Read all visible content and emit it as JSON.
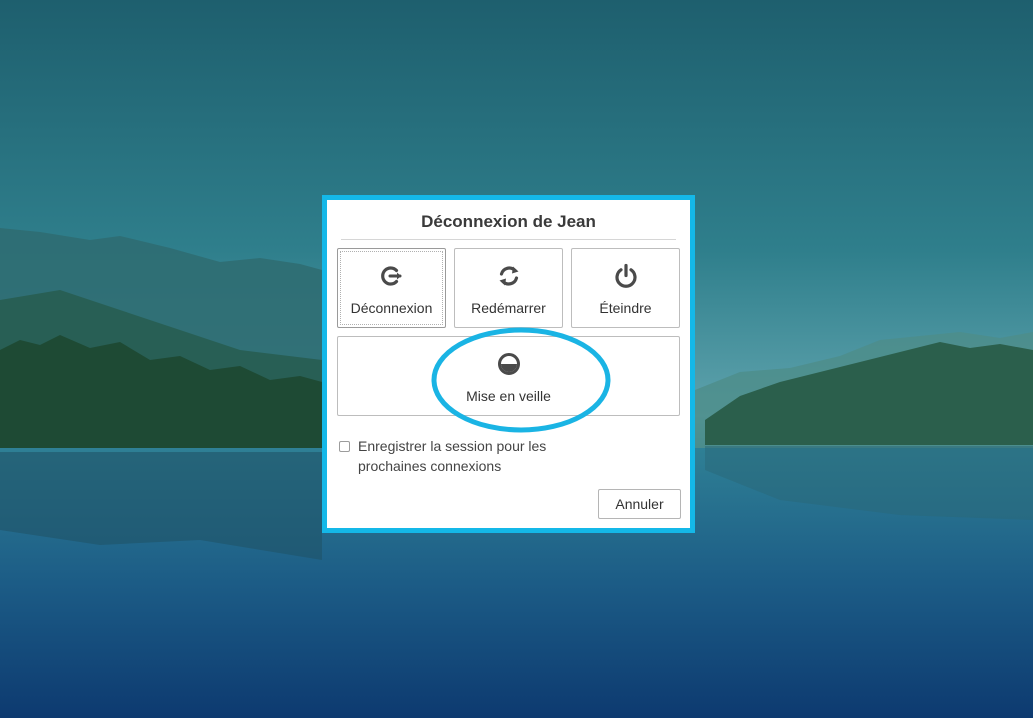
{
  "dialog": {
    "title": "Déconnexion de Jean",
    "buttons": {
      "logout": {
        "label": "Déconnexion",
        "icon": "logout-icon"
      },
      "restart": {
        "label": "Redémarrer",
        "icon": "restart-icon"
      },
      "shutdown": {
        "label": "Éteindre",
        "icon": "power-icon"
      },
      "sleep": {
        "label": "Mise en veille",
        "icon": "sleep-icon"
      }
    },
    "save_session": {
      "label": "Enregistrer la session pour les prochaines connexions",
      "checked": false
    },
    "cancel_label": "Annuler"
  },
  "colors": {
    "frame": "#14b8e8",
    "highlight": "#1ab4e4",
    "icon": "#4a4a4a"
  }
}
